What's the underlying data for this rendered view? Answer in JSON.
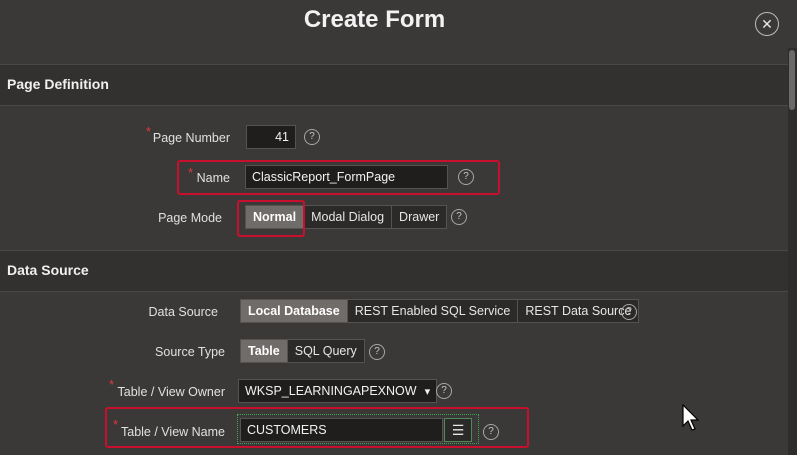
{
  "dialog": {
    "title": "Create Form",
    "close_icon": "close-icon"
  },
  "page_definition": {
    "header": "Page Definition",
    "page_number": {
      "label": "Page Number",
      "value": "41"
    },
    "name": {
      "label": "Name",
      "value": "ClassicReport_FormPage"
    },
    "page_mode": {
      "label": "Page Mode",
      "options": [
        "Normal",
        "Modal Dialog",
        "Drawer"
      ],
      "selected": "Normal"
    }
  },
  "data_source": {
    "header": "Data Source",
    "data_source": {
      "label": "Data Source",
      "options": [
        "Local Database",
        "REST Enabled SQL Service",
        "REST Data Source"
      ],
      "selected": "Local Database"
    },
    "source_type": {
      "label": "Source Type",
      "options": [
        "Table",
        "SQL Query"
      ],
      "selected": "Table"
    },
    "table_owner": {
      "label": "Table / View Owner",
      "value": "WKSP_LEARNINGAPEXNOW"
    },
    "table_name": {
      "label": "Table / View Name",
      "value": "CUSTOMERS"
    }
  },
  "required_mark": "*",
  "help_glyph": "?",
  "accent": {
    "highlight_box": "#c8102e",
    "selected_segment": "#6f6c69"
  }
}
